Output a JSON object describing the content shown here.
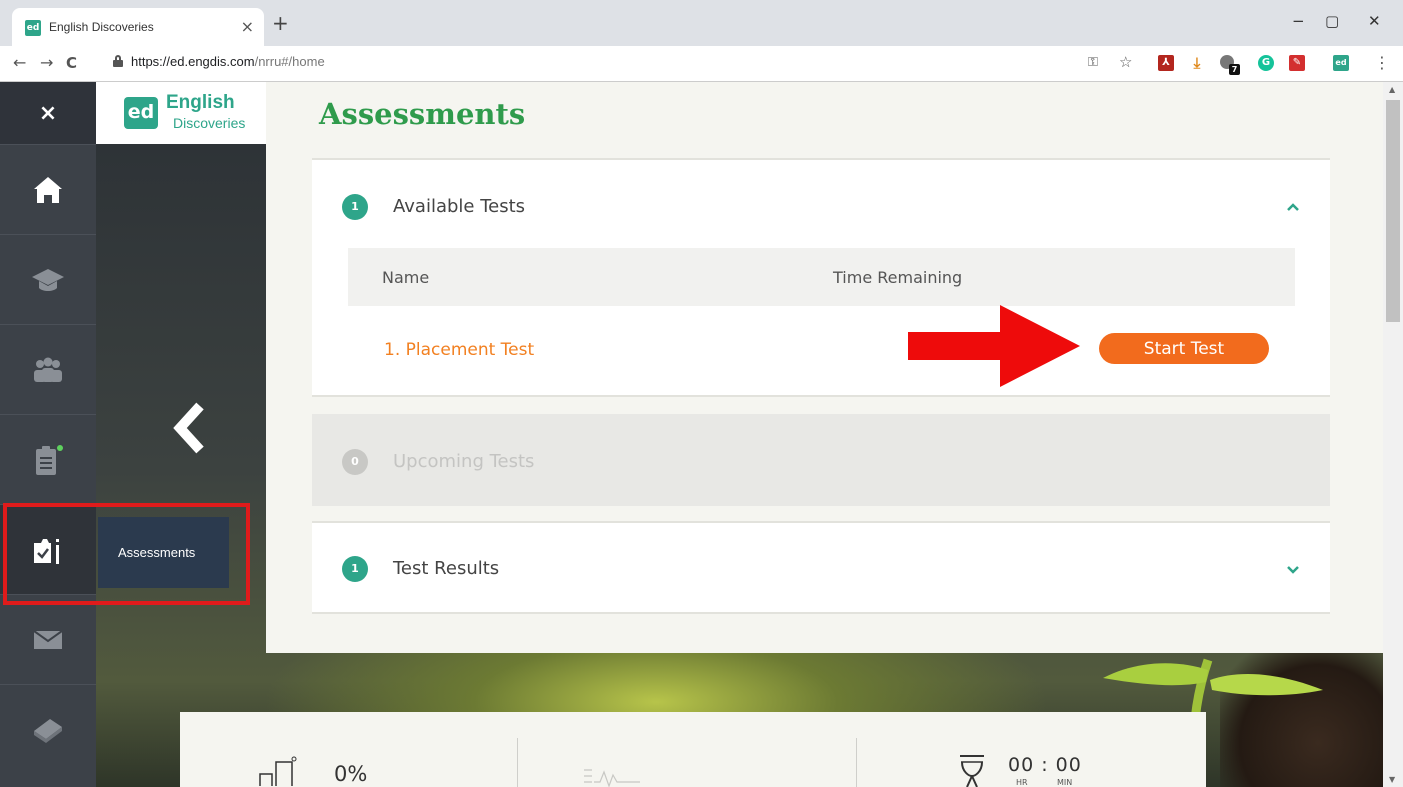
{
  "browser": {
    "tab_title": "English Discoveries",
    "tab_favicon": "ed",
    "tab_close": "×",
    "new_tab": "+",
    "url_host": "https://ed.engdis.com",
    "url_path": "/nrru#/home",
    "minimize": "−",
    "restore": "▢",
    "close": "✕",
    "back": "←",
    "forward": "→",
    "reload": "C",
    "key_icon": "⚿",
    "star_icon": "☆",
    "menu_icon": "⋮",
    "extensions": [
      {
        "icon": "pdf-extension-icon",
        "glyph": "⁂",
        "color": "#b3261e"
      },
      {
        "icon": "download-extension-icon",
        "glyph": "⤓",
        "color": "#e08a1e"
      },
      {
        "icon": "puzzle-extension-icon",
        "glyph": "7",
        "color": "#555555"
      },
      {
        "icon": "grammarly-extension-icon",
        "glyph": "G",
        "color": "#15c39a"
      },
      {
        "icon": "adobe-extension-icon",
        "glyph": "✎",
        "color": "#d32f2f"
      },
      {
        "icon": "ed-extension-icon",
        "glyph": "ed",
        "color": "#2ea58a"
      }
    ]
  },
  "sidebar": {
    "close_label": "×",
    "items": [
      {
        "icon": "home-icon",
        "active": false
      },
      {
        "icon": "graduation-cap-icon",
        "active": false
      },
      {
        "icon": "community-icon",
        "active": false
      },
      {
        "icon": "clipboard-icon",
        "active": false,
        "has_notification": true
      },
      {
        "icon": "assessments-icon",
        "active": true
      },
      {
        "icon": "envelope-icon",
        "active": false
      },
      {
        "icon": "book-icon",
        "active": false
      }
    ],
    "tooltip": "Assessments",
    "collapse_arrow": "‹"
  },
  "brand": {
    "logo": "ed",
    "name": "English",
    "sub": "Discoveries"
  },
  "main": {
    "title": "Assessments",
    "available": {
      "count": "1",
      "title": "Available Tests",
      "chevron": "^",
      "columns": [
        "Name",
        "Time Remaining"
      ],
      "tests": [
        {
          "name": "1. Placement Test",
          "action": "Start Test"
        }
      ]
    },
    "upcoming": {
      "count": "0",
      "title": "Upcoming Tests"
    },
    "results": {
      "count": "1",
      "title": "Test Results",
      "chevron": "v"
    }
  },
  "stats": {
    "progress": "0%",
    "time": "00 : 00",
    "time_hr": "HR",
    "time_min": "MIN"
  },
  "colors": {
    "brand_green": "#2ea58a",
    "title_green": "#2f9b4c",
    "orange": "#f26b1d",
    "annotation_red": "#e01b1b"
  }
}
